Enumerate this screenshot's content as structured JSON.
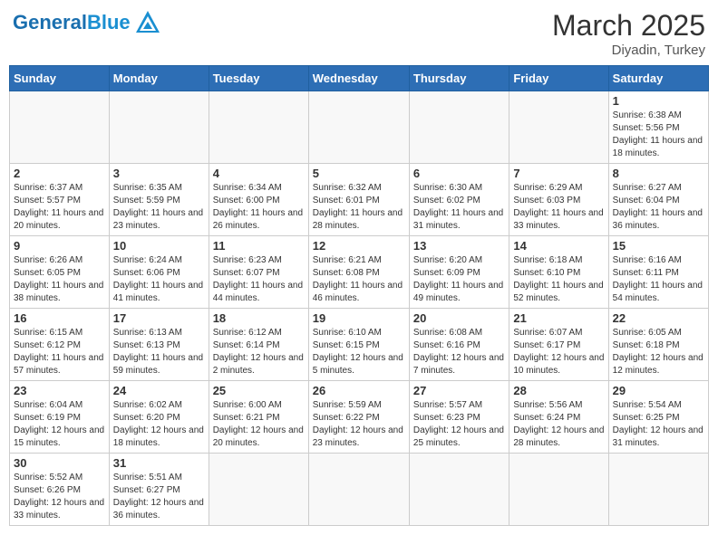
{
  "header": {
    "logo_general": "General",
    "logo_blue": "Blue",
    "month_year": "March 2025",
    "location": "Diyadin, Turkey"
  },
  "days_of_week": [
    "Sunday",
    "Monday",
    "Tuesday",
    "Wednesday",
    "Thursday",
    "Friday",
    "Saturday"
  ],
  "weeks": [
    [
      {
        "day": "",
        "info": ""
      },
      {
        "day": "",
        "info": ""
      },
      {
        "day": "",
        "info": ""
      },
      {
        "day": "",
        "info": ""
      },
      {
        "day": "",
        "info": ""
      },
      {
        "day": "",
        "info": ""
      },
      {
        "day": "1",
        "info": "Sunrise: 6:38 AM\nSunset: 5:56 PM\nDaylight: 11 hours and 18 minutes."
      }
    ],
    [
      {
        "day": "2",
        "info": "Sunrise: 6:37 AM\nSunset: 5:57 PM\nDaylight: 11 hours and 20 minutes."
      },
      {
        "day": "3",
        "info": "Sunrise: 6:35 AM\nSunset: 5:59 PM\nDaylight: 11 hours and 23 minutes."
      },
      {
        "day": "4",
        "info": "Sunrise: 6:34 AM\nSunset: 6:00 PM\nDaylight: 11 hours and 26 minutes."
      },
      {
        "day": "5",
        "info": "Sunrise: 6:32 AM\nSunset: 6:01 PM\nDaylight: 11 hours and 28 minutes."
      },
      {
        "day": "6",
        "info": "Sunrise: 6:30 AM\nSunset: 6:02 PM\nDaylight: 11 hours and 31 minutes."
      },
      {
        "day": "7",
        "info": "Sunrise: 6:29 AM\nSunset: 6:03 PM\nDaylight: 11 hours and 33 minutes."
      },
      {
        "day": "8",
        "info": "Sunrise: 6:27 AM\nSunset: 6:04 PM\nDaylight: 11 hours and 36 minutes."
      }
    ],
    [
      {
        "day": "9",
        "info": "Sunrise: 6:26 AM\nSunset: 6:05 PM\nDaylight: 11 hours and 38 minutes."
      },
      {
        "day": "10",
        "info": "Sunrise: 6:24 AM\nSunset: 6:06 PM\nDaylight: 11 hours and 41 minutes."
      },
      {
        "day": "11",
        "info": "Sunrise: 6:23 AM\nSunset: 6:07 PM\nDaylight: 11 hours and 44 minutes."
      },
      {
        "day": "12",
        "info": "Sunrise: 6:21 AM\nSunset: 6:08 PM\nDaylight: 11 hours and 46 minutes."
      },
      {
        "day": "13",
        "info": "Sunrise: 6:20 AM\nSunset: 6:09 PM\nDaylight: 11 hours and 49 minutes."
      },
      {
        "day": "14",
        "info": "Sunrise: 6:18 AM\nSunset: 6:10 PM\nDaylight: 11 hours and 52 minutes."
      },
      {
        "day": "15",
        "info": "Sunrise: 6:16 AM\nSunset: 6:11 PM\nDaylight: 11 hours and 54 minutes."
      }
    ],
    [
      {
        "day": "16",
        "info": "Sunrise: 6:15 AM\nSunset: 6:12 PM\nDaylight: 11 hours and 57 minutes."
      },
      {
        "day": "17",
        "info": "Sunrise: 6:13 AM\nSunset: 6:13 PM\nDaylight: 11 hours and 59 minutes."
      },
      {
        "day": "18",
        "info": "Sunrise: 6:12 AM\nSunset: 6:14 PM\nDaylight: 12 hours and 2 minutes."
      },
      {
        "day": "19",
        "info": "Sunrise: 6:10 AM\nSunset: 6:15 PM\nDaylight: 12 hours and 5 minutes."
      },
      {
        "day": "20",
        "info": "Sunrise: 6:08 AM\nSunset: 6:16 PM\nDaylight: 12 hours and 7 minutes."
      },
      {
        "day": "21",
        "info": "Sunrise: 6:07 AM\nSunset: 6:17 PM\nDaylight: 12 hours and 10 minutes."
      },
      {
        "day": "22",
        "info": "Sunrise: 6:05 AM\nSunset: 6:18 PM\nDaylight: 12 hours and 12 minutes."
      }
    ],
    [
      {
        "day": "23",
        "info": "Sunrise: 6:04 AM\nSunset: 6:19 PM\nDaylight: 12 hours and 15 minutes."
      },
      {
        "day": "24",
        "info": "Sunrise: 6:02 AM\nSunset: 6:20 PM\nDaylight: 12 hours and 18 minutes."
      },
      {
        "day": "25",
        "info": "Sunrise: 6:00 AM\nSunset: 6:21 PM\nDaylight: 12 hours and 20 minutes."
      },
      {
        "day": "26",
        "info": "Sunrise: 5:59 AM\nSunset: 6:22 PM\nDaylight: 12 hours and 23 minutes."
      },
      {
        "day": "27",
        "info": "Sunrise: 5:57 AM\nSunset: 6:23 PM\nDaylight: 12 hours and 25 minutes."
      },
      {
        "day": "28",
        "info": "Sunrise: 5:56 AM\nSunset: 6:24 PM\nDaylight: 12 hours and 28 minutes."
      },
      {
        "day": "29",
        "info": "Sunrise: 5:54 AM\nSunset: 6:25 PM\nDaylight: 12 hours and 31 minutes."
      }
    ],
    [
      {
        "day": "30",
        "info": "Sunrise: 5:52 AM\nSunset: 6:26 PM\nDaylight: 12 hours and 33 minutes."
      },
      {
        "day": "31",
        "info": "Sunrise: 5:51 AM\nSunset: 6:27 PM\nDaylight: 12 hours and 36 minutes."
      },
      {
        "day": "",
        "info": ""
      },
      {
        "day": "",
        "info": ""
      },
      {
        "day": "",
        "info": ""
      },
      {
        "day": "",
        "info": ""
      },
      {
        "day": "",
        "info": ""
      }
    ]
  ]
}
